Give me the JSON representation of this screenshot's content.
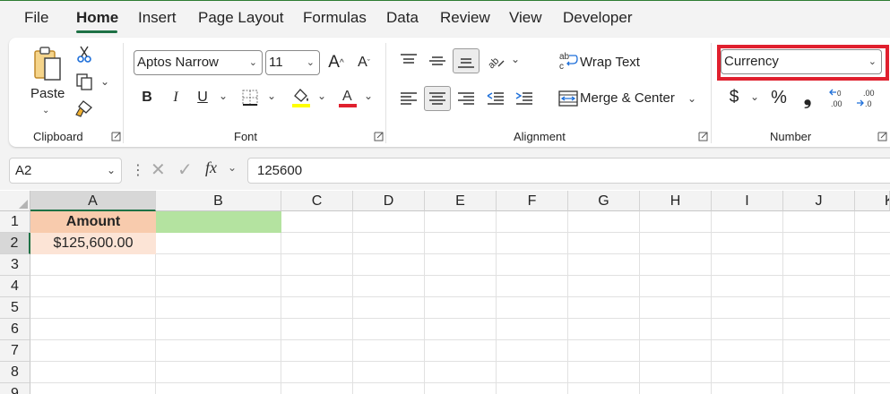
{
  "tabs": [
    {
      "label": "File",
      "active": false
    },
    {
      "label": "Home",
      "active": true
    },
    {
      "label": "Insert",
      "active": false
    },
    {
      "label": "Page Layout",
      "active": false
    },
    {
      "label": "Formulas",
      "active": false
    },
    {
      "label": "Data",
      "active": false
    },
    {
      "label": "Review",
      "active": false
    },
    {
      "label": "View",
      "active": false
    },
    {
      "label": "Developer",
      "active": false
    }
  ],
  "ribbon": {
    "clipboard": {
      "group_label": "Clipboard",
      "paste_label": "Paste"
    },
    "font": {
      "group_label": "Font",
      "font_name": "Aptos Narrow",
      "font_size": "11",
      "bold": "B",
      "italic": "I",
      "underline": "U"
    },
    "alignment": {
      "group_label": "Alignment",
      "wrap_text": "Wrap Text",
      "merge_center": "Merge & Center"
    },
    "number": {
      "group_label": "Number",
      "format": "Currency",
      "dollar": "$",
      "percent": "%",
      "comma": "❟"
    }
  },
  "formula_bar": {
    "name_box": "A2",
    "fx": "fx",
    "value": "125600"
  },
  "columns": [
    "A",
    "B",
    "C",
    "D",
    "E",
    "F",
    "G",
    "H",
    "I",
    "J",
    "K"
  ],
  "rows": [
    "1",
    "2",
    "3",
    "4",
    "5",
    "6",
    "7",
    "8",
    "9"
  ],
  "cells": {
    "a1": "Amount",
    "a2": "$125,600.00"
  },
  "colors": {
    "accent": "#1e7145",
    "header_fill_a1": "#f8cbad",
    "fill_a2": "#fce4d6",
    "fill_b1": "#b4e3a0",
    "highlight_outline": "#e0202e"
  }
}
